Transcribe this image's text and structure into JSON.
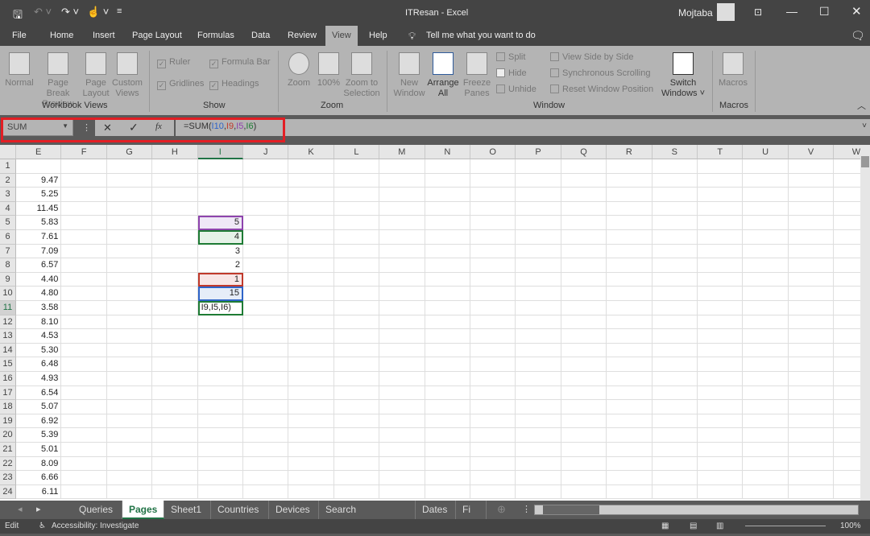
{
  "title": "ITResan  -  Excel",
  "user": "Mojtaba",
  "menu_tabs": [
    "File",
    "Home",
    "Insert",
    "Page Layout",
    "Formulas",
    "Data",
    "Review",
    "View",
    "Help"
  ],
  "active_tab": "View",
  "tell_me": "Tell me what you want to do",
  "ribbon": {
    "workbook_views": {
      "label": "Workbook Views",
      "items": [
        "Normal",
        "Page Break Preview",
        "Page Layout",
        "Custom Views"
      ]
    },
    "show": {
      "label": "Show",
      "items": [
        {
          "label": "Ruler",
          "checked": true
        },
        {
          "label": "Formula Bar",
          "checked": true
        },
        {
          "label": "Gridlines",
          "checked": true
        },
        {
          "label": "Headings",
          "checked": true
        }
      ]
    },
    "zoom": {
      "label": "Zoom",
      "items": [
        "Zoom",
        "100%",
        "Zoom to Selection"
      ]
    },
    "window": {
      "label": "Window",
      "items": [
        "New Window",
        "Arrange All",
        "Freeze Panes",
        "Split",
        "Hide",
        "Unhide",
        "View Side by Side",
        "Synchronous Scrolling",
        "Reset Window Position",
        "Switch Windows"
      ]
    },
    "macros": {
      "label": "Macros",
      "items": [
        "Macros"
      ]
    }
  },
  "formula_bar": {
    "name_box": "SUM",
    "formula_prefix": "=SUM(",
    "refs": [
      {
        "text": "I10",
        "color": "#2e64c8"
      },
      {
        "text": "I9",
        "color": "#c0392b"
      },
      {
        "text": "I5",
        "color": "#8e44ad"
      },
      {
        "text": "I6",
        "color": "#1e7b34"
      }
    ],
    "formula_suffix": ")",
    "cancel": "✕",
    "enter": "✓",
    "fx": "fx"
  },
  "columns": [
    "E",
    "F",
    "G",
    "H",
    "I",
    "J",
    "K",
    "L",
    "M",
    "N",
    "O",
    "P",
    "Q",
    "R",
    "S",
    "T",
    "U",
    "V",
    "W"
  ],
  "rows": [
    1,
    2,
    3,
    4,
    5,
    6,
    7,
    8,
    9,
    10,
    11,
    12,
    13,
    14,
    15,
    16,
    17,
    18,
    19,
    20,
    21,
    22,
    23,
    24
  ],
  "column_E": [
    "",
    "9.47",
    "5.25",
    "11.45",
    "5.83",
    "7.61",
    "7.09",
    "6.57",
    "4.40",
    "4.80",
    "3.58",
    "8.10",
    "4.53",
    "5.30",
    "6.48",
    "4.93",
    "6.54",
    "5.07",
    "6.92",
    "5.39",
    "5.01",
    "8.09",
    "6.66",
    "6.11"
  ],
  "column_I": {
    "5": "5",
    "6": "4",
    "7": "3",
    "8": "2",
    "9": "1",
    "10": "15",
    "11": "I9,I5,I6)"
  },
  "selected_cell": "I11",
  "sheet_tabs": [
    "Queries",
    "Pages",
    "Sheet1",
    "Countries",
    "Devices",
    "Search appearance",
    "Dates",
    "Fi ..."
  ],
  "active_sheet": "Pages",
  "status": {
    "mode": "Edit",
    "accessibility": "Accessibility: Investigate",
    "zoom": "100%"
  }
}
